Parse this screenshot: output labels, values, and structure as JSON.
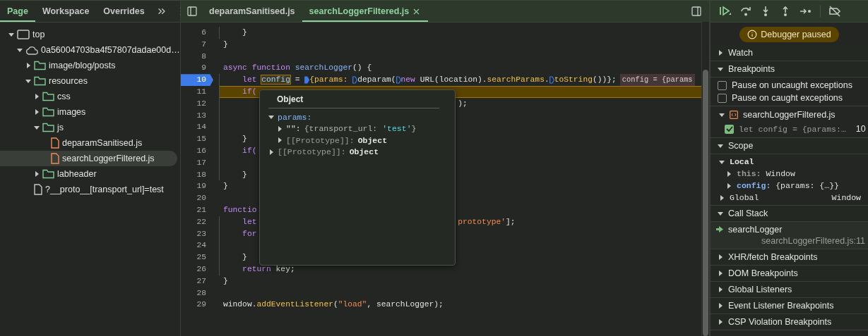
{
  "left_panel": {
    "tabs": [
      {
        "label": "Page",
        "selected": true
      },
      {
        "label": "Workspace",
        "selected": false
      },
      {
        "label": "Overrides",
        "selected": false
      }
    ],
    "tree": [
      {
        "label": "top",
        "kind": "frame",
        "expanded": true,
        "selected": false,
        "children": [
          {
            "label": "0a56004703ba4f57807dadae00d…",
            "kind": "domain",
            "expanded": true,
            "selected": false,
            "children": [
              {
                "label": "image/blog/posts",
                "kind": "folder",
                "expanded": false,
                "selected": false
              },
              {
                "label": "resources",
                "kind": "folder",
                "expanded": true,
                "selected": false,
                "children": [
                  {
                    "label": "css",
                    "kind": "folder",
                    "expanded": false,
                    "selected": false
                  },
                  {
                    "label": "images",
                    "kind": "folder",
                    "expanded": false,
                    "selected": false
                  },
                  {
                    "label": "js",
                    "kind": "folder",
                    "expanded": true,
                    "selected": false,
                    "children": [
                      {
                        "label": "deparamSanitised.js",
                        "kind": "script",
                        "selected": false
                      },
                      {
                        "label": "searchLoggerFiltered.js",
                        "kind": "script",
                        "selected": true
                      }
                    ]
                  },
                  {
                    "label": "labheader",
                    "kind": "folder",
                    "expanded": false,
                    "selected": false
                  }
                ]
              },
              {
                "label": "?__proto__[transport_url]=test",
                "kind": "document",
                "selected": false
              }
            ]
          }
        ]
      }
    ]
  },
  "editor": {
    "tabs": [
      {
        "label": "deparamSanitised.js",
        "selected": false
      },
      {
        "label": "searchLoggerFiltered.js",
        "selected": true
      }
    ],
    "lines": [
      {
        "number": "6",
        "breakpoint": false,
        "paused": false,
        "indent": true,
        "tokens": [
          {
            "kind": "plain",
            "text": "}"
          }
        ]
      },
      {
        "number": "7",
        "breakpoint": false,
        "paused": false,
        "indent": false,
        "tokens": [
          {
            "kind": "plain",
            "text": "}"
          }
        ]
      },
      {
        "number": "8",
        "breakpoint": false,
        "paused": false,
        "indent": false
      },
      {
        "number": "9",
        "breakpoint": false,
        "paused": false,
        "indent": false,
        "tokens": [
          {
            "kind": "kw",
            "text": "async function"
          },
          {
            "kind": "def",
            "text": " searchLogger"
          },
          {
            "kind": "plain",
            "text": "() {"
          }
        ]
      },
      {
        "number": "10",
        "breakpoint": true,
        "paused": false,
        "indent": true,
        "inline_value": "config = {params",
        "tokens": [
          {
            "kind": "kw",
            "text": "let "
          },
          {
            "kind": "hover",
            "text": "config"
          },
          {
            "kind": "plain",
            "text": " = "
          },
          {
            "kind": "marker",
            "on": true
          },
          {
            "kind": "call",
            "text": "{params: "
          },
          {
            "kind": "marker",
            "on": false
          },
          {
            "kind": "plain",
            "text": "deparam("
          },
          {
            "kind": "marker",
            "on": false
          },
          {
            "kind": "kw",
            "text": "new"
          },
          {
            "kind": "plain",
            "text": " URL(location)."
          },
          {
            "kind": "call",
            "text": "searchParams"
          },
          {
            "kind": "plain",
            "text": "."
          },
          {
            "kind": "marker",
            "on": false
          },
          {
            "kind": "call",
            "text": "toString"
          },
          {
            "kind": "plain",
            "text": "())};"
          }
        ]
      },
      {
        "number": "11",
        "breakpoint": false,
        "paused": true,
        "indent": true,
        "tokens": [
          {
            "kind": "kw",
            "text": "if("
          }
        ]
      },
      {
        "number": "12",
        "breakpoint": false,
        "paused": false,
        "indent": true,
        "tail": [
          {
            "kind": "plain",
            "text": ");"
          }
        ]
      },
      {
        "number": "13",
        "breakpoint": false,
        "paused": false,
        "indent": true
      },
      {
        "number": "14",
        "breakpoint": false,
        "paused": false,
        "indent": true
      },
      {
        "number": "15",
        "breakpoint": false,
        "paused": false,
        "indent": true,
        "tokens": [
          {
            "kind": "plain",
            "text": "}"
          }
        ]
      },
      {
        "number": "16",
        "breakpoint": false,
        "paused": false,
        "indent": true,
        "tokens": [
          {
            "kind": "kw",
            "text": "if("
          }
        ]
      },
      {
        "number": "17",
        "breakpoint": false,
        "paused": false,
        "indent": true
      },
      {
        "number": "18",
        "breakpoint": false,
        "paused": false,
        "indent": true,
        "tokens": [
          {
            "kind": "plain",
            "text": "}"
          }
        ]
      },
      {
        "number": "19",
        "breakpoint": false,
        "paused": false,
        "indent": false,
        "tokens": [
          {
            "kind": "plain",
            "text": "}"
          }
        ]
      },
      {
        "number": "20",
        "breakpoint": false,
        "paused": false,
        "indent": false
      },
      {
        "number": "21",
        "breakpoint": false,
        "paused": false,
        "indent": false,
        "tokens": [
          {
            "kind": "kw",
            "text": "functio"
          }
        ]
      },
      {
        "number": "22",
        "breakpoint": false,
        "paused": false,
        "indent": true,
        "tokens": [
          {
            "kind": "kw",
            "text": "let"
          }
        ],
        "tail": [
          {
            "kind": "str",
            "text": "prototype'"
          },
          {
            "kind": "plain",
            "text": "];"
          }
        ]
      },
      {
        "number": "23",
        "breakpoint": false,
        "paused": false,
        "indent": true,
        "tokens": [
          {
            "kind": "kw",
            "text": "for"
          }
        ]
      },
      {
        "number": "24",
        "breakpoint": false,
        "paused": false,
        "indent": true
      },
      {
        "number": "25",
        "breakpoint": false,
        "paused": false,
        "indent": true,
        "tokens": [
          {
            "kind": "plain",
            "text": "}"
          }
        ]
      },
      {
        "number": "26",
        "breakpoint": false,
        "paused": false,
        "indent": true,
        "tokens": [
          {
            "kind": "kw",
            "text": "return"
          },
          {
            "kind": "plain",
            "text": " key;"
          }
        ]
      },
      {
        "number": "27",
        "breakpoint": false,
        "paused": false,
        "indent": false,
        "tokens": [
          {
            "kind": "plain",
            "text": "}"
          }
        ]
      },
      {
        "number": "28",
        "breakpoint": false,
        "paused": false,
        "indent": false
      },
      {
        "number": "29",
        "breakpoint": false,
        "paused": false,
        "indent": false,
        "tokens": [
          {
            "kind": "plain",
            "text": "window."
          },
          {
            "kind": "call",
            "text": "addEventListener"
          },
          {
            "kind": "plain",
            "text": "("
          },
          {
            "kind": "str",
            "text": "\"load\""
          },
          {
            "kind": "plain",
            "text": ", searchLogger);"
          }
        ]
      }
    ],
    "popover": {
      "title": "Object",
      "entries": [
        {
          "key": "params:",
          "kind": "own",
          "expanded": true,
          "children": [
            {
              "key": "\"\":",
              "kind": "plain",
              "expanded": false,
              "value": [
                {
                  "kind": "dim",
                  "text": "{transport_url: "
                },
                {
                  "kind": "str",
                  "text": "'test'"
                },
                {
                  "kind": "dim",
                  "text": "}"
                }
              ]
            },
            {
              "key": "[[Prototype]]:",
              "kind": "internal",
              "expanded": false,
              "value": [
                {
                  "kind": "obj",
                  "text": "Object"
                }
              ]
            }
          ]
        },
        {
          "key": "[[Prototype]]:",
          "kind": "internal",
          "expanded": false,
          "value": [
            {
              "kind": "obj",
              "text": "Object"
            }
          ]
        }
      ]
    }
  },
  "debugger": {
    "banner": "Debugger paused",
    "sections": [
      {
        "kind": "plain",
        "title": "Watch",
        "expanded": false
      },
      {
        "kind": "breakpoints",
        "title": "Breakpoints",
        "expanded": true,
        "options": [
          {
            "label": "Pause on uncaught exceptions",
            "checked": false
          },
          {
            "label": "Pause on caught exceptions",
            "checked": false
          }
        ],
        "files": [
          {
            "name": "searchLoggerFiltered.js",
            "expanded": true,
            "breakpoints": [
              {
                "code": "let config = {params:…",
                "line": "10",
                "checked": true
              }
            ]
          }
        ]
      },
      {
        "kind": "scope",
        "title": "Scope",
        "expanded": true,
        "groups": [
          {
            "name": "Local",
            "expanded": true,
            "vars": [
              {
                "key": "this:",
                "kind": "internal",
                "value": "Window",
                "expanded": false
              },
              {
                "key": "config:",
                "kind": "own",
                "value": "{params: {…}}",
                "expanded": false
              }
            ]
          },
          {
            "name": "Global",
            "expanded": false,
            "value": "Window"
          }
        ]
      },
      {
        "kind": "callstack",
        "title": "Call Stack",
        "expanded": true,
        "frames": [
          {
            "function": "searchLogger",
            "location": "searchLoggerFiltered.js:11",
            "current": true
          }
        ]
      },
      {
        "kind": "plain",
        "title": "XHR/fetch Breakpoints",
        "expanded": false
      },
      {
        "kind": "plain",
        "title": "DOM Breakpoints",
        "expanded": false
      },
      {
        "kind": "plain",
        "title": "Global Listeners",
        "expanded": false
      },
      {
        "kind": "plain",
        "title": "Event Listener Breakpoints",
        "expanded": false
      },
      {
        "kind": "plain",
        "title": "CSP Violation Breakpoints",
        "expanded": false
      }
    ]
  }
}
